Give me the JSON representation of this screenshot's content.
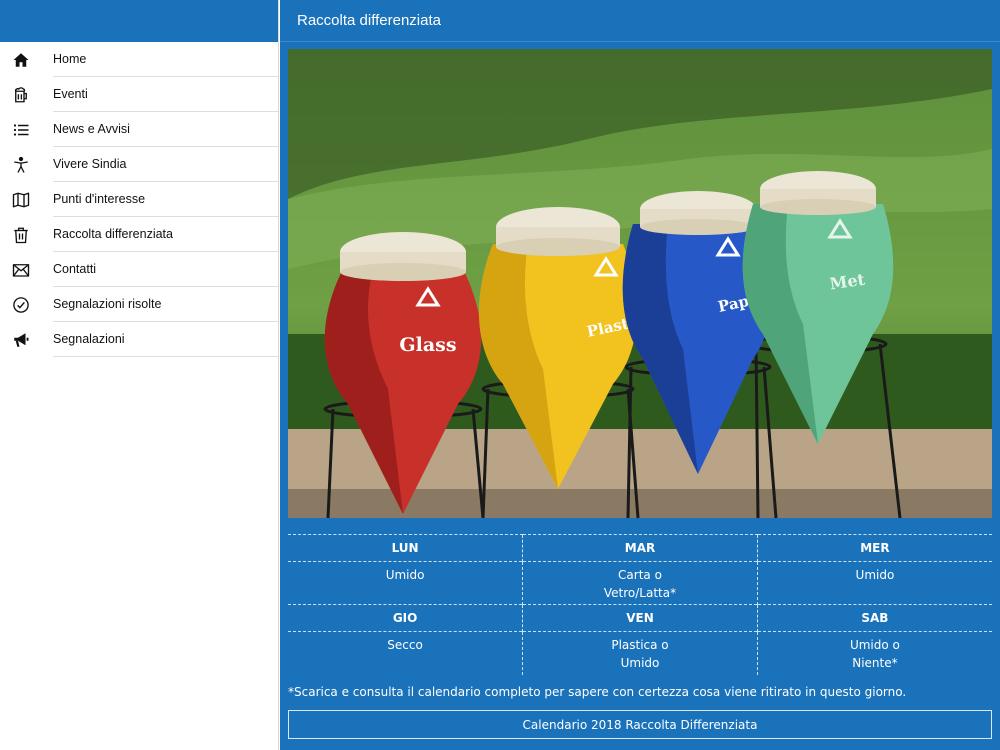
{
  "sidebar": {
    "items": [
      {
        "label": "Home",
        "icon": "home-icon"
      },
      {
        "label": "Eventi",
        "icon": "beer-mug-icon"
      },
      {
        "label": "News e Avvisi",
        "icon": "list-icon"
      },
      {
        "label": "Vivere Sindia",
        "icon": "accessibility-icon"
      },
      {
        "label": "Punti d'interesse",
        "icon": "map-icon"
      },
      {
        "label": "Raccolta differenziata",
        "icon": "trash-icon"
      },
      {
        "label": "Contatti",
        "icon": "envelope-icon"
      },
      {
        "label": "Segnalazioni risolte",
        "icon": "check-circle-icon"
      },
      {
        "label": "Segnalazioni",
        "icon": "megaphone-icon"
      }
    ]
  },
  "header": {
    "title": "Raccolta differenziata"
  },
  "photo": {
    "bins": [
      {
        "label": "Glass",
        "color": "#c8302a"
      },
      {
        "label": "Plastic",
        "color": "#f2c21f"
      },
      {
        "label": "Paper",
        "color": "#2758c8"
      },
      {
        "label": "Metal",
        "color": "#6fc59a"
      }
    ]
  },
  "schedule": {
    "rows": [
      {
        "days": [
          "LUN",
          "MAR",
          "MER"
        ],
        "values": [
          [
            "Umido"
          ],
          [
            "Carta o",
            "Vetro/Latta*"
          ],
          [
            "Umido"
          ]
        ]
      },
      {
        "days": [
          "GIO",
          "VEN",
          "SAB"
        ],
        "values": [
          [
            "Secco"
          ],
          [
            "Plastica o",
            "Umido"
          ],
          [
            "Umido o",
            "Niente*"
          ]
        ]
      }
    ]
  },
  "footnote": "*Scarica e consulta il calendario completo per sapere con certezza cosa viene ritirato in questo giorno.",
  "calendar_button": "Calendario 2018 Raccolta Differenziata",
  "colors": {
    "brand": "#1a72bb",
    "text": "#111111"
  }
}
